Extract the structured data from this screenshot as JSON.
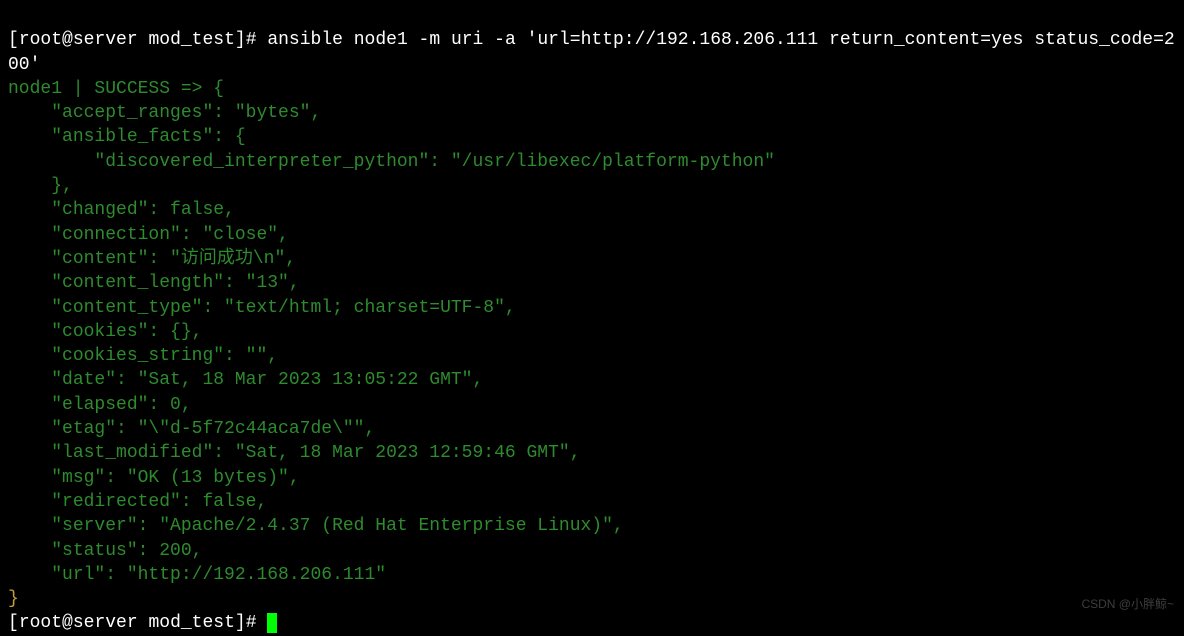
{
  "prompt1": {
    "user": "root",
    "host": "server",
    "dir": "mod_test",
    "symbol": "#",
    "command": "ansible node1 -m uri -a 'url=http://192.168.206.111 return_content=yes status_code=200'"
  },
  "result": {
    "host_status": "node1 | SUCCESS => {",
    "lines": [
      "    \"accept_ranges\": \"bytes\",",
      "    \"ansible_facts\": {",
      "        \"discovered_interpreter_python\": \"/usr/libexec/platform-python\"",
      "    },",
      "    \"changed\": false,",
      "    \"connection\": \"close\",",
      "    \"content\": \"访问成功\\n\",",
      "    \"content_length\": \"13\",",
      "    \"content_type\": \"text/html; charset=UTF-8\",",
      "    \"cookies\": {},",
      "    \"cookies_string\": \"\",",
      "    \"date\": \"Sat, 18 Mar 2023 13:05:22 GMT\",",
      "    \"elapsed\": 0,",
      "    \"etag\": \"\\\"d-5f72c44aca7de\\\"\",",
      "    \"last_modified\": \"Sat, 18 Mar 2023 12:59:46 GMT\",",
      "    \"msg\": \"OK (13 bytes)\",",
      "    \"redirected\": false,",
      "    \"server\": \"Apache/2.4.37 (Red Hat Enterprise Linux)\",",
      "    \"status\": 200,",
      "    \"url\": \"http://192.168.206.111\"",
      "}"
    ]
  },
  "prompt2": {
    "user": "root",
    "host": "server",
    "dir": "mod_test",
    "symbol": "#"
  },
  "watermark": "CSDN @小胖鲸~"
}
